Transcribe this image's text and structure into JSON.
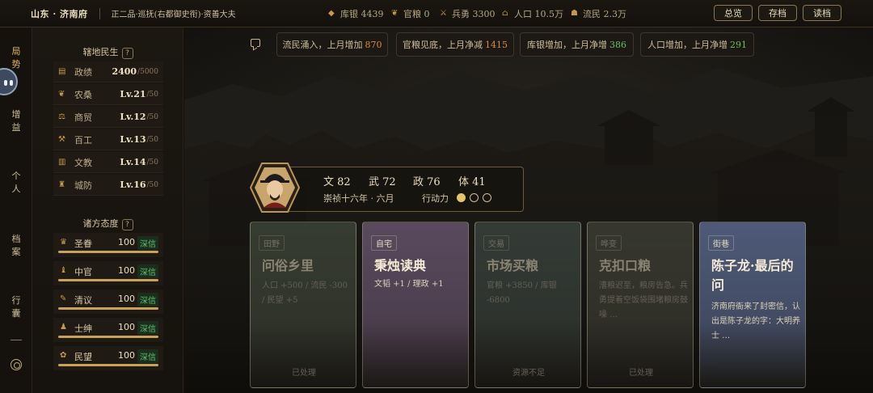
{
  "header": {
    "location": "山东 · 济南府",
    "rank": "正二品·巡抚(右都御史衔)·资善大夫",
    "resources": [
      {
        "icon": "silver-icon",
        "label": "库银",
        "value": "4439"
      },
      {
        "icon": "grain-icon",
        "label": "官粮",
        "value": "0"
      },
      {
        "icon": "soldier-icon",
        "label": "兵勇",
        "value": "3300"
      },
      {
        "icon": "population-icon",
        "label": "人口",
        "value": "10.5万"
      },
      {
        "icon": "refugee-icon",
        "label": "流民",
        "value": "2.3万"
      }
    ],
    "buttons": {
      "overview": "总览",
      "save": "存档",
      "load": "读档"
    }
  },
  "nav": {
    "items": [
      "局\n势",
      "增\n益",
      "个\n人",
      "档\n案",
      "行\n囊"
    ],
    "active_index": 0
  },
  "governance": {
    "title": "辖地民生",
    "help": "?",
    "rows": [
      {
        "icon": "politics-icon",
        "name": "政绩",
        "value": "2400",
        "max": "/5000"
      },
      {
        "icon": "farming-icon",
        "name": "农桑",
        "value": "Lv.21",
        "max": "/50"
      },
      {
        "icon": "trade-icon",
        "name": "商贸",
        "value": "Lv.12",
        "max": "/50"
      },
      {
        "icon": "craft-icon",
        "name": "百工",
        "value": "Lv.13",
        "max": "/50"
      },
      {
        "icon": "education-icon",
        "name": "文教",
        "value": "Lv.14",
        "max": "/50"
      },
      {
        "icon": "defense-icon",
        "name": "城防",
        "value": "Lv.16",
        "max": "/50"
      }
    ]
  },
  "attitudes": {
    "title": "诸方态度",
    "help": "?",
    "rows": [
      {
        "icon": "emperor-icon",
        "name": "圣眷",
        "value": "100",
        "badge": "深信",
        "level": 1.0
      },
      {
        "icon": "eunuch-icon",
        "name": "中官",
        "value": "100",
        "badge": "深信",
        "level": 1.0
      },
      {
        "icon": "scholar-icon",
        "name": "清议",
        "value": "100",
        "badge": "深信",
        "level": 1.0
      },
      {
        "icon": "gentry-icon",
        "name": "士绅",
        "value": "100",
        "badge": "深信",
        "level": 1.0
      },
      {
        "icon": "people-icon",
        "name": "民望",
        "value": "100",
        "badge": "深信",
        "level": 1.0
      }
    ]
  },
  "notifications": [
    {
      "text": "流民涌入，上月增加",
      "value": "870",
      "color": "#d98b3d"
    },
    {
      "text": "官粮见底，上月净减",
      "value": "1415",
      "color": "#d98b3d"
    },
    {
      "text": "库银增加，上月净增",
      "value": "386",
      "color": "#6fbf5f"
    },
    {
      "text": "人口增加，上月净增",
      "value": "291",
      "color": "#6fbf5f"
    }
  ],
  "character": {
    "stats": [
      {
        "label": "文",
        "value": "82"
      },
      {
        "label": "武",
        "value": "72"
      },
      {
        "label": "政",
        "value": "76"
      },
      {
        "label": "体",
        "value": "41"
      }
    ],
    "date": "崇祯十六年 · 六月",
    "action_label": "行动力",
    "action_points": 1,
    "action_max": 3
  },
  "cards": [
    {
      "tag": "田野",
      "title": "问俗乡里",
      "desc": "人口 +500 / 流民 -300 / 民望 +5",
      "status": "已处理",
      "style": "dim",
      "tint": "#4a5444"
    },
    {
      "tag": "自宅",
      "title": "秉烛读典",
      "desc": "文韬 +1 / 理政 +1",
      "status": "",
      "style": "lit",
      "tint": "#5a4a5e"
    },
    {
      "tag": "交易",
      "title": "市场买粮",
      "desc": "官粮 +3850 / 库银 -6800",
      "status": "资源不足",
      "style": "dim",
      "tint": "#46524c"
    },
    {
      "tag": "哗变",
      "title": "克扣口粮",
      "desc": "漕粮迟至，粮房告急。兵勇提着空饭袋围堵粮房鼓噪 …",
      "status": "已处理",
      "style": "dim",
      "tint": "#4a4c40"
    },
    {
      "tag": "街巷",
      "title": "陈子龙·最后的问",
      "desc": "济南府衙来了封密信，认出是陈子龙的字：大明养士 …",
      "status": "",
      "style": "lit",
      "tint": "#4e5a78"
    }
  ]
}
